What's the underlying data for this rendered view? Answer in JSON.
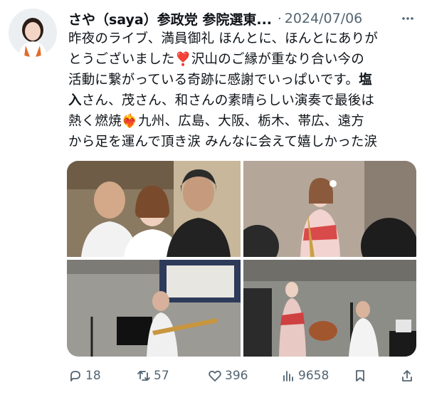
{
  "author": {
    "name": "さや（saya）参政党 参院選東...",
    "separator": "·",
    "date": "2024/07/06"
  },
  "post": {
    "line1": "昨夜のライブ、満員御礼 ほんとに、ほんとにありが",
    "line2a": "とうございました",
    "line2b": "沢山のご縁が重なり合い今の",
    "line3a": "活動に繋がっている奇跡に感謝でいっぱいです。",
    "line3b": "塩",
    "line4a": "入",
    "line4b": "さん、茂さん、和さんの素晴らしい演奏で最後は",
    "line5a": "熱く燃焼",
    "line5b": "九州、広島、大阪、栃木、帯広、遠方",
    "line6": "から足を運んで頂き涙 みんなに会えて嬉しかった涙"
  },
  "emojis": {
    "heart": "❣️",
    "fire_heart": "❤️‍🔥"
  },
  "stats": {
    "replies": "18",
    "reposts": "57",
    "likes": "396",
    "views": "9658"
  },
  "icons": [
    "more-icon",
    "reply-icon",
    "repost-icon",
    "like-icon",
    "views-icon",
    "bookmark-icon",
    "share-icon"
  ]
}
